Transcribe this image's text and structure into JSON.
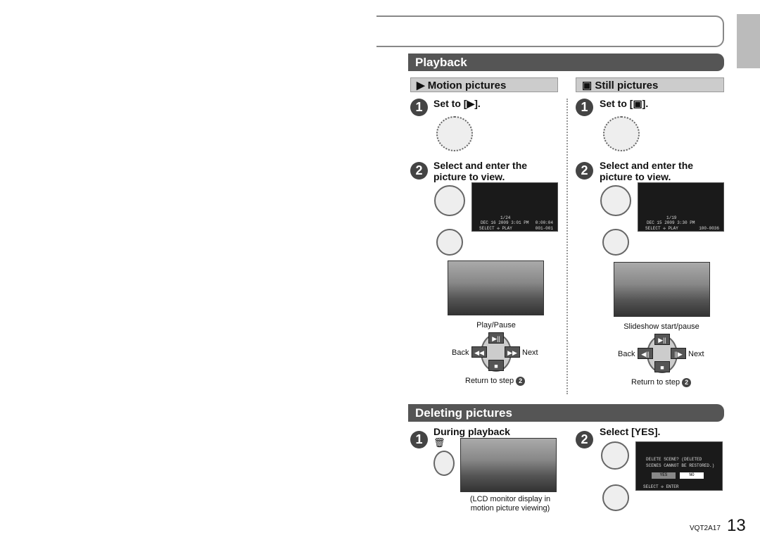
{
  "playback": {
    "title": "Playback",
    "motion": {
      "title": "Motion pictures",
      "step1": "Set to [▶].",
      "step2": "Select and enter the picture to view.",
      "lcd": {
        "counter": "1/24",
        "date": "DEC 16 2009",
        "time": "3:01 PM",
        "duration": "0:00:04",
        "select": "SELECT",
        "play": "PLAY",
        "file": "001-001"
      },
      "labels": {
        "top": "Play/Pause",
        "left": "Back",
        "right": "Next",
        "bottom": "Return to step"
      }
    },
    "still": {
      "title": "Still pictures",
      "step1": "Set to [▣].",
      "step2": "Select and enter the picture to view.",
      "lcd": {
        "counter": "1/19",
        "date": "DEC 15 2009",
        "time": "3:30 PM",
        "select": "SELECT",
        "play": "PLAY",
        "file": "100-0036"
      },
      "labels": {
        "top": "Slideshow start/pause",
        "left": "Back",
        "right": "Next",
        "bottom": "Return to step"
      }
    }
  },
  "deleting": {
    "title": "Deleting pictures",
    "step1": "During playback",
    "step2": "Select [YES].",
    "caption": "(LCD monitor display in motion picture viewing)",
    "dialog": {
      "message": "DELETE SCENE? (DELETED SCENES CANNOT BE RESTORED.)",
      "yes": "YES",
      "no": "NO",
      "select": "SELECT",
      "enter": "ENTER"
    }
  },
  "footer": {
    "code": "VQT2A17",
    "page": "13"
  },
  "nums": {
    "one": "1",
    "two": "2"
  }
}
